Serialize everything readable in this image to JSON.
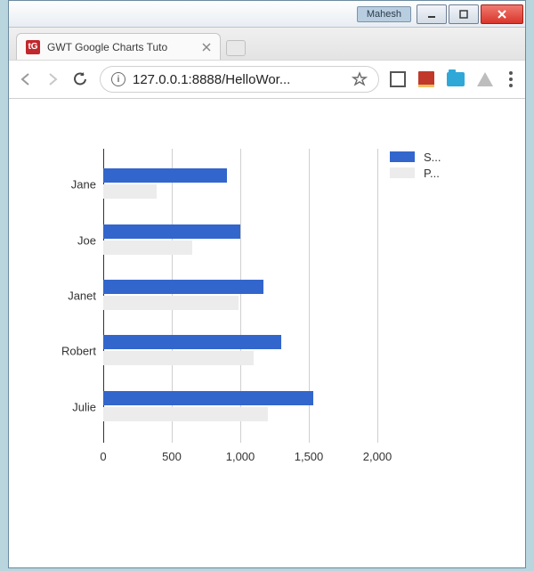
{
  "titlebar": {
    "user": "Mahesh"
  },
  "tab": {
    "title": "GWT Google Charts Tuto"
  },
  "address": {
    "url": "127.0.0.1:8888/HelloWor..."
  },
  "chart_data": {
    "type": "bar",
    "orientation": "horizontal",
    "categories": [
      "Jane",
      "Joe",
      "Janet",
      "Robert",
      "Julie"
    ],
    "series": [
      {
        "name": "S...",
        "values": [
          900,
          1000,
          1170,
          1300,
          1530
        ]
      },
      {
        "name": "P...",
        "values": [
          390,
          650,
          990,
          1100,
          1200
        ]
      }
    ],
    "xlabel": "",
    "ylabel": "",
    "xlim": [
      0,
      2000
    ],
    "xticks": [
      0,
      500,
      1000,
      1500,
      2000
    ],
    "xtick_labels": [
      "0",
      "500",
      "1,000",
      "1,500",
      "2,000"
    ],
    "legend_position": "right",
    "colors": {
      "S": "#3366cc",
      "P": "#ececec"
    }
  }
}
